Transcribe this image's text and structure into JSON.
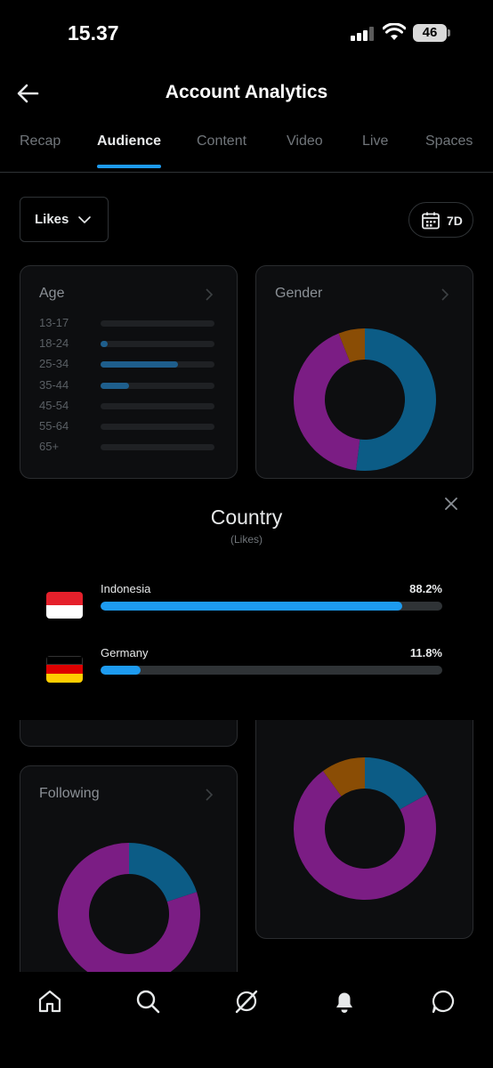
{
  "status_bar": {
    "time": "15.37",
    "battery": "46",
    "signal_icon": "cellular-signal-icon",
    "wifi_icon": "wifi-icon"
  },
  "header": {
    "title": "Account Analytics",
    "back_icon": "arrow-left-icon"
  },
  "tabs": [
    {
      "label": "Recap",
      "active": false
    },
    {
      "label": "Audience",
      "active": true
    },
    {
      "label": "Content",
      "active": false
    },
    {
      "label": "Video",
      "active": false
    },
    {
      "label": "Live",
      "active": false
    },
    {
      "label": "Spaces",
      "active": false
    }
  ],
  "filters": {
    "metric": "Likes",
    "range": "7D",
    "calendar_icon": "calendar-icon"
  },
  "age_card": {
    "title": "Age",
    "rows": [
      {
        "label": "13-17",
        "fraction": 0.0
      },
      {
        "label": "18-24",
        "fraction": 0.06
      },
      {
        "label": "25-34",
        "fraction": 0.68
      },
      {
        "label": "35-44",
        "fraction": 0.25
      },
      {
        "label": "45-54",
        "fraction": 0.0
      },
      {
        "label": "55-64",
        "fraction": 0.0
      },
      {
        "label": "65+",
        "fraction": 0.0
      }
    ]
  },
  "gender_card": {
    "title": "Gender",
    "slices": [
      {
        "value": 0.52,
        "color": "#0c5c86"
      },
      {
        "value": 0.42,
        "color": "#7b1d84"
      },
      {
        "value": 0.06,
        "color": "#8a4d05"
      }
    ]
  },
  "country_sheet": {
    "title": "Country",
    "subtitle": "(Likes)",
    "countries": [
      {
        "name": "Indonesia",
        "percent": "88.2%",
        "fraction": 0.882,
        "flag": [
          "#e5202b",
          "#ffffff"
        ]
      },
      {
        "name": "Germany",
        "percent": "11.8%",
        "fraction": 0.118,
        "flag": [
          "#000000",
          "#dd0000",
          "#ffce00"
        ]
      }
    ]
  },
  "following_card": {
    "title": "Following",
    "slices": [
      {
        "value": 0.2,
        "color": "#0c5c86"
      },
      {
        "value": 0.8,
        "color": "#7b1d84"
      }
    ]
  },
  "right_lower_card": {
    "slices": [
      {
        "value": 0.17,
        "color": "#0c5c86"
      },
      {
        "value": 0.73,
        "color": "#7b1d84"
      },
      {
        "value": 0.1,
        "color": "#8a4d05"
      }
    ]
  },
  "colors": {
    "accent": "#1d9bf0",
    "tab_underline": "#1d9bf0"
  },
  "bottom_nav": [
    "home-icon",
    "search-icon",
    "grok-icon",
    "notifications-icon",
    "messages-icon"
  ]
}
